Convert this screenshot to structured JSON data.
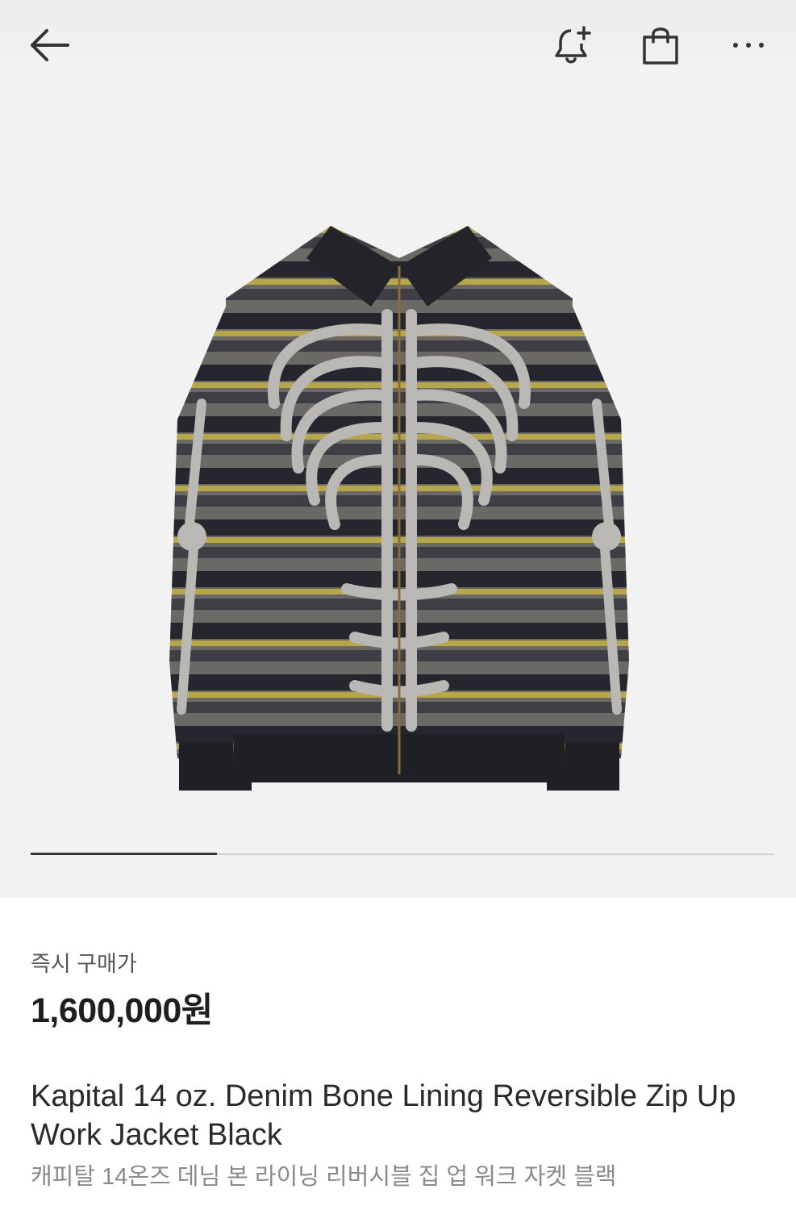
{
  "header": {
    "icons": [
      "back-arrow-icon",
      "bell-add-icon",
      "shopping-bag-icon",
      "more-icon"
    ]
  },
  "gallery": {
    "image_alt": "jacket",
    "progress_fraction": 0.25
  },
  "product": {
    "price_label": "즉시 구매가",
    "price": "1,600,000원",
    "name_en": "Kapital 14 oz. Denim Bone Lining Reversible Zip Up Work Jacket Black",
    "name_ko": "캐피탈 14온즈 데님 본 라이닝 리버시블 집 업 워크 자켓 블랙"
  },
  "colors": {
    "top_bar_bg": "#ececec",
    "gallery_bg": "#f2f2f2",
    "progress_fill": "#333333",
    "progress_track": "#d0d0d0",
    "subtext": "#8a8a8a"
  }
}
